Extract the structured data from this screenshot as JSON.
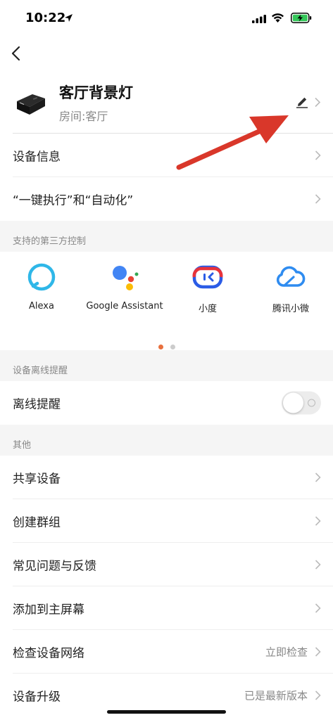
{
  "status_bar": {
    "time": "10:22",
    "icons": [
      "location-arrow-icon",
      "cellular-signal-icon",
      "wifi-icon",
      "battery-charging-icon"
    ],
    "battery_color": "#34c759"
  },
  "nav": {
    "back_icon": "chevron-left-icon"
  },
  "device": {
    "name": "客厅背景灯",
    "room": "房间:客厅",
    "edit_icon": "pencil-icon"
  },
  "rows_top": [
    {
      "label": "设备信息"
    },
    {
      "label": "“一键执行”和“自动化”"
    }
  ],
  "third_party": {
    "title": "支持的第三方控制",
    "items": [
      {
        "label": "Alexa",
        "icon": "alexa-icon"
      },
      {
        "label": "Google Assistant",
        "icon": "google-assistant-icon"
      },
      {
        "label": "小度",
        "icon": "xiaodu-icon"
      },
      {
        "label": "腾讯小微",
        "icon": "tencent-xiaowei-icon"
      }
    ],
    "pages": 2,
    "current_page": 1,
    "accent": "#e8703e"
  },
  "offline": {
    "title": "设备离线提醒",
    "label": "离线提醒",
    "enabled": false
  },
  "others": {
    "title": "其他",
    "rows": [
      {
        "label": "共享设备",
        "value": ""
      },
      {
        "label": "创建群组",
        "value": ""
      },
      {
        "label": "常见问题与反馈",
        "value": ""
      },
      {
        "label": "添加到主屏幕",
        "value": ""
      },
      {
        "label": "检查设备网络",
        "value": "立即检查"
      },
      {
        "label": "设备升级",
        "value": "已是最新版本"
      }
    ]
  },
  "annotation": {
    "arrow_color": "#d9372a"
  }
}
